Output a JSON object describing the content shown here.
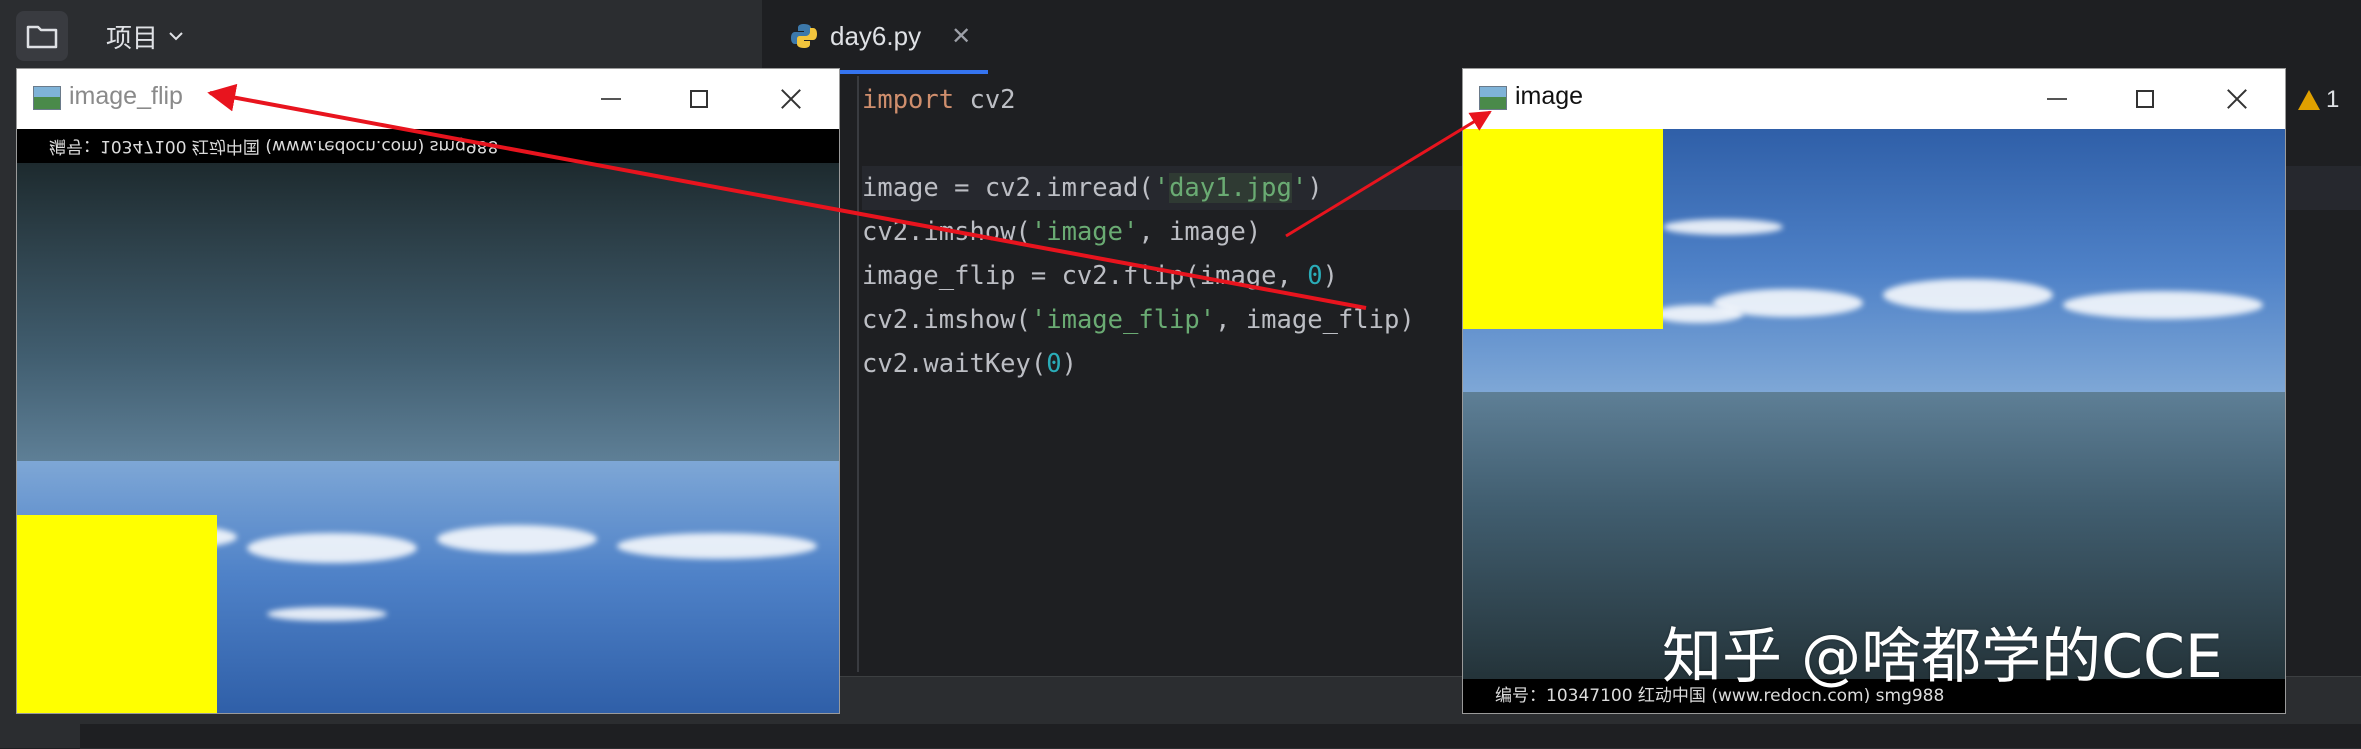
{
  "ide": {
    "project_menu_label": "项目",
    "active_tab": "day6.py",
    "warning_count": "1"
  },
  "code": {
    "line1": {
      "kw": "import",
      "rest": " cv2"
    },
    "line3": {
      "a": "image = cv2.imread(",
      "q1": "'",
      "s": "day1.jpg",
      "q2": "'",
      "b": ")"
    },
    "line4": {
      "a": "cv2.imshow(",
      "s": "'image'",
      "b": ", image)"
    },
    "line5": {
      "a": "image_flip = cv2.flip(image, ",
      "n": "0",
      "b": ")"
    },
    "line6": {
      "a": "cv2.imshow(",
      "s": "'image_flip'",
      "b": ", image_flip)"
    },
    "line7": {
      "a": "cv2.waitKey(",
      "n": "0",
      "b": ")"
    }
  },
  "windows": {
    "flip": {
      "title": "image_flip",
      "watermark_text": "编号：10347100   红动中国 (www.redocn.com)   smg988"
    },
    "image": {
      "title": "image",
      "watermark_text": "编号：10347100   红动中国 (www.redocn.com)   smg988"
    }
  },
  "overlay": {
    "watermark": "知乎 @啥都学的CCE"
  },
  "colors": {
    "accent": "#3574f0",
    "highlight_yellow": "#ffff00",
    "arrow_red": "#e8141e",
    "keyword": "#cf8e6d",
    "string": "#6aab73",
    "number": "#2aacb8"
  }
}
